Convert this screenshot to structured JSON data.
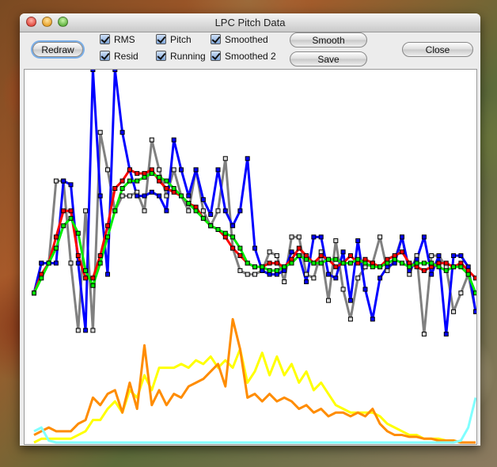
{
  "window": {
    "title": "LPC Pitch Data"
  },
  "toolbar": {
    "redraw": "Redraw",
    "smooth": "Smooth",
    "save": "Save",
    "close": "Close",
    "checkboxes": [
      {
        "label": "RMS",
        "checked": true
      },
      {
        "label": "Resid",
        "checked": true
      },
      {
        "label": "Pitch",
        "checked": true
      },
      {
        "label": "Running",
        "checked": true
      },
      {
        "label": "Smoothed",
        "checked": true
      },
      {
        "label": "Smoothed 2",
        "checked": true
      }
    ]
  },
  "chart_data": {
    "type": "line",
    "grid": false,
    "ylim": [
      0,
      100
    ],
    "series": [
      {
        "color": "#808080",
        "markers": true,
        "values": [
          40,
          48,
          48,
          70,
          70,
          48,
          30,
          62,
          30,
          83,
          73,
          62,
          66,
          66,
          67,
          62,
          81,
          73,
          66,
          73,
          66,
          62,
          73,
          62,
          58,
          62,
          76,
          52,
          46,
          45,
          45,
          46,
          51,
          50,
          43,
          55,
          55,
          45,
          44,
          51,
          38,
          54,
          41,
          33,
          44,
          47,
          48,
          55,
          46,
          49,
          55,
          45,
          50,
          29,
          50,
          50,
          47,
          35,
          40,
          45,
          35
        ]
      },
      {
        "color": "#0000ff",
        "markers": true,
        "values": [
          40,
          48,
          48,
          48,
          70,
          69,
          48,
          30,
          100,
          66,
          45,
          100,
          83,
          73,
          66,
          66,
          67,
          66,
          62,
          81,
          73,
          66,
          73,
          65,
          61,
          73,
          62,
          58,
          62,
          76,
          52,
          46,
          45,
          45,
          46,
          51,
          50,
          43,
          55,
          55,
          45,
          44,
          51,
          38,
          54,
          41,
          33,
          44,
          47,
          48,
          55,
          46,
          49,
          55,
          45,
          50,
          29,
          50,
          50,
          47,
          35
        ]
      },
      {
        "color": "#ff0000",
        "markers": true,
        "values": [
          40,
          45,
          48,
          55,
          62,
          62,
          50,
          44,
          44,
          50,
          58,
          68,
          70,
          73,
          72,
          72,
          73,
          70,
          68,
          67,
          66,
          64,
          63,
          60,
          58,
          57,
          55,
          52,
          50,
          48,
          47,
          47,
          48,
          48,
          47,
          49,
          52,
          50,
          48,
          50,
          49,
          47,
          48,
          50,
          48,
          49,
          48,
          47,
          49,
          50,
          51,
          48,
          47,
          46,
          47,
          48,
          48,
          47,
          48,
          46,
          44
        ]
      },
      {
        "color": "#00ee00",
        "markers": true,
        "values": [
          40,
          44,
          48,
          52,
          58,
          60,
          56,
          46,
          42,
          48,
          55,
          62,
          68,
          70,
          70,
          71,
          72,
          71,
          70,
          68,
          66,
          64,
          62,
          60,
          58,
          57,
          56,
          55,
          52,
          48,
          47,
          47,
          46,
          46,
          47,
          48,
          50,
          49,
          48,
          48,
          49,
          49,
          48,
          48,
          49,
          48,
          47,
          47,
          48,
          49,
          48,
          47,
          48,
          48,
          48,
          47,
          46,
          47,
          47,
          45,
          40
        ]
      },
      {
        "color": "#ffff00",
        "markers": false,
        "values": [
          0,
          1,
          1,
          1,
          1,
          1,
          2,
          3,
          6,
          6,
          9,
          11,
          8,
          14,
          12,
          18,
          14,
          20,
          20,
          20,
          21,
          20,
          22,
          21,
          23,
          20,
          22,
          20,
          25,
          16,
          19,
          24,
          18,
          23,
          18,
          21,
          16,
          19,
          14,
          16,
          13,
          10,
          9,
          8,
          8,
          8,
          8,
          7,
          5,
          4,
          3,
          2,
          2,
          1,
          1,
          1,
          0.5,
          0.5,
          0,
          0,
          0
        ]
      },
      {
        "color": "#ff8c00",
        "markers": false,
        "values": [
          2,
          3,
          4,
          3,
          3,
          3,
          5,
          6,
          12,
          10,
          13,
          14,
          8,
          16,
          9,
          26,
          10,
          14,
          10,
          13,
          12,
          15,
          16,
          17,
          19,
          21,
          15,
          33,
          25,
          12,
          13,
          11,
          13,
          11,
          12,
          11,
          9,
          10,
          8,
          9,
          7,
          8,
          8,
          7,
          8,
          7,
          9,
          5,
          3,
          2,
          2,
          1.5,
          1.5,
          1,
          1,
          0.5,
          0.5,
          0.5,
          0,
          0,
          0
        ]
      },
      {
        "color": "#80ffff",
        "markers": false,
        "values": [
          3,
          4,
          0.5,
          0,
          0,
          0,
          0,
          0,
          0,
          0,
          0,
          0,
          0,
          0,
          0,
          0,
          0,
          0,
          0,
          0,
          0,
          0,
          0,
          0,
          0,
          0,
          0,
          0,
          0,
          0,
          0,
          0,
          0,
          0,
          0,
          0,
          0,
          0,
          0,
          0,
          0,
          0,
          0,
          0,
          0,
          0,
          0,
          0,
          0,
          0,
          0,
          0,
          0,
          0,
          0,
          0,
          0,
          0,
          0.5,
          4,
          12
        ]
      }
    ]
  }
}
